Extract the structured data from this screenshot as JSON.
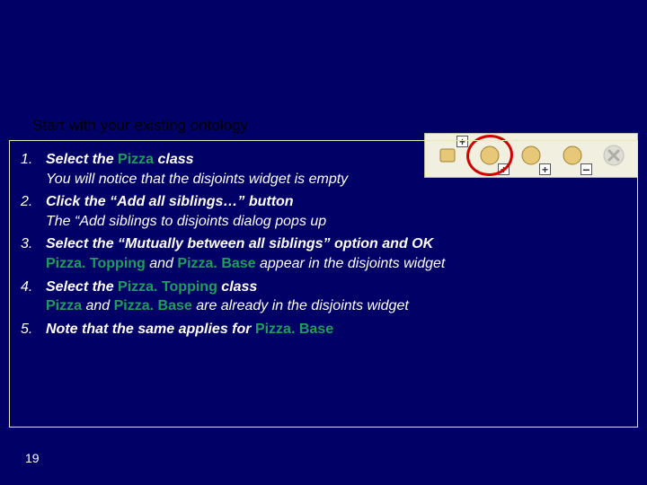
{
  "lead": "Start with your existing ontology",
  "steps": [
    {
      "line1_pre": "Select the ",
      "line1_kw": "Pizza",
      "line1_post": " class",
      "line2": "You will notice that the disjoints widget is empty"
    },
    {
      "line1": "Click the “Add all siblings…” button",
      "line2": "The “Add siblings to disjoints dialog pops up"
    },
    {
      "line1": "Select the “Mutually between all siblings” option and OK",
      "line2_kw1": "Pizza. Topping",
      "line2_mid": " and ",
      "line2_kw2": "Pizza. Base",
      "line2_post": " appear in the disjoints widget"
    },
    {
      "line1_pre": "Select the ",
      "line1_kw": "Pizza. Topping",
      "line1_post": " class",
      "line2_kw1": "Pizza",
      "line2_mid": " and ",
      "line2_kw2": "Pizza. Base",
      "line2_post": " are already in the disjoints widget"
    },
    {
      "line1_pre": "Note that the same applies for ",
      "line1_kw": "Pizza. Base",
      "line1_post": ""
    }
  ],
  "page_number": "19",
  "toolbar": {
    "buttons": [
      {
        "name": "add-sibling-classes",
        "badge": "plus-tr",
        "highlighted": false
      },
      {
        "name": "add-all-siblings",
        "badge": "plus-br",
        "highlighted": true
      },
      {
        "name": "add-subclass",
        "badge": "plus-br",
        "highlighted": false
      },
      {
        "name": "remove-class",
        "badge": "minus-br",
        "highlighted": false
      },
      {
        "name": "delete-class",
        "badge": "x",
        "highlighted": false,
        "disabled": true
      }
    ]
  }
}
